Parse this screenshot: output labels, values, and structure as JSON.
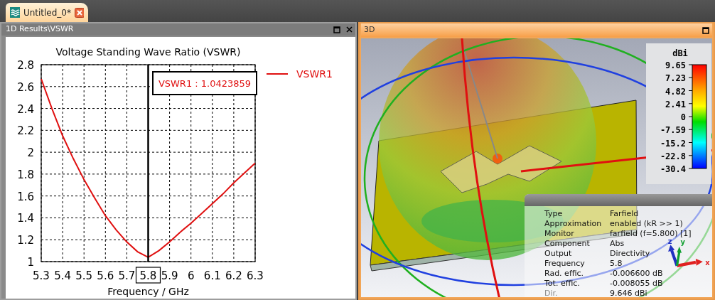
{
  "tab": {
    "title": "Untitled_0*",
    "selected": true
  },
  "results_panel": {
    "title": "1D Results\\VSWR",
    "chart_data": {
      "type": "line",
      "title": "Voltage Standing Wave Ratio (VSWR)",
      "xlabel": "Frequency / GHz",
      "x": [
        5.3,
        5.35,
        5.4,
        5.45,
        5.5,
        5.55,
        5.6,
        5.65,
        5.7,
        5.75,
        5.8,
        5.85,
        5.9,
        5.95,
        6.0,
        6.05,
        6.1,
        6.15,
        6.2,
        6.25,
        6.3
      ],
      "series": [
        {
          "name": "VSWR1",
          "color": "#e01010",
          "values": [
            2.67,
            2.4,
            2.15,
            1.94,
            1.75,
            1.58,
            1.42,
            1.29,
            1.18,
            1.09,
            1.04,
            1.1,
            1.18,
            1.27,
            1.35,
            1.44,
            1.53,
            1.62,
            1.72,
            1.81,
            1.9
          ]
        }
      ],
      "xlim": [
        5.3,
        6.3
      ],
      "ylim": [
        1,
        2.8
      ],
      "xticks": [
        5.3,
        5.4,
        5.5,
        5.6,
        5.7,
        5.8,
        5.9,
        6,
        6.1,
        6.2,
        6.3
      ],
      "yticks": [
        1,
        1.2,
        1.4,
        1.6,
        1.8,
        2,
        2.2,
        2.4,
        2.6,
        2.8
      ],
      "grid": true,
      "ref_lines": [
        {
          "axis": "x",
          "value": 5.8
        }
      ],
      "annotations": [
        "VSWR1 : 1.0423859"
      ]
    }
  },
  "view_panel": {
    "title": "3D",
    "legend": {
      "unit": "dBi",
      "ticks": [
        "9.65",
        "7.23",
        "4.82",
        "2.41",
        "0",
        "-7.59",
        "-15.2",
        "-22.8",
        "-30.4"
      ]
    },
    "info": [
      {
        "label": "Type",
        "value": "Farfield",
        "dimmed": false
      },
      {
        "label": "Approximation",
        "value": "enabled (kR >> 1)",
        "dimmed": false
      },
      {
        "label": "Monitor",
        "value": "farfield (f=5.800) [1]",
        "dimmed": false
      },
      {
        "label": "Component",
        "value": "Abs",
        "dimmed": false
      },
      {
        "label": "Output",
        "value": "Directivity",
        "dimmed": false
      },
      {
        "label": "Frequency",
        "value": "5.8",
        "dimmed": false
      },
      {
        "label": "Rad. effic.",
        "value": "-0.006600 dB",
        "dimmed": false
      },
      {
        "label": "Tot. effic.",
        "value": "-0.008055 dB",
        "dimmed": false
      },
      {
        "label": "Dir.",
        "value": "9.646 dBi",
        "dimmed": true
      }
    ],
    "axes": [
      "x",
      "y",
      "z"
    ]
  }
}
